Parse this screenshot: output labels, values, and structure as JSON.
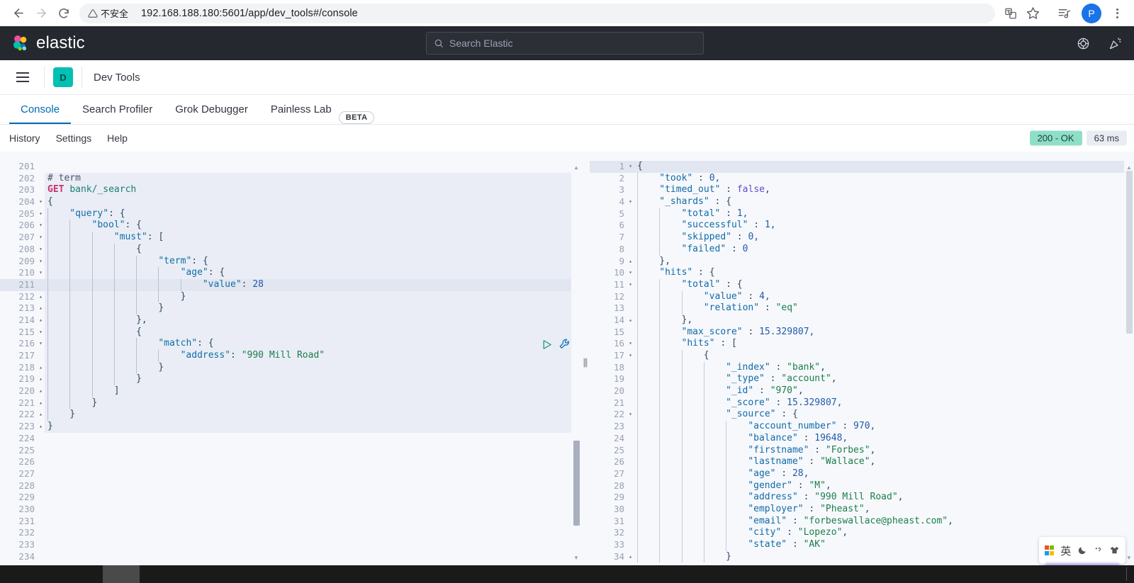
{
  "browser": {
    "back_icon": "back-arrow-icon",
    "forward_icon": "forward-arrow-icon",
    "reload_icon": "reload-icon",
    "security_label": "不安全",
    "url": "192.168.188.180:5601/app/dev_tools#/console",
    "translate_icon": "translate-icon",
    "bookmark_icon": "star-icon",
    "media_icon": "media-list-icon",
    "profile_initial": "P",
    "menu_icon": "kebab-menu-icon"
  },
  "elastic_header": {
    "brand": "elastic",
    "logo_icon": "elastic-logo-icon",
    "search_placeholder": "Search Elastic",
    "search_icon": "search-icon",
    "help_icon": "help-circle-icon",
    "news_icon": "announcement-icon"
  },
  "app_bar": {
    "menu_icon": "hamburger-menu-icon",
    "app_initial": "D",
    "title": "Dev Tools"
  },
  "tabs": [
    {
      "label": "Console",
      "active": true
    },
    {
      "label": "Search Profiler",
      "active": false
    },
    {
      "label": "Grok Debugger",
      "active": false
    },
    {
      "label": "Painless Lab",
      "active": false
    }
  ],
  "beta_badge": "BETA",
  "sub_toolbar": {
    "links": [
      "History",
      "Settings",
      "Help"
    ],
    "status_code": "200 - OK",
    "duration": "63 ms"
  },
  "editor": {
    "run_icon": "play-triangle-icon",
    "wrench_icon": "wrench-icon",
    "highlighted_line": 211,
    "lines": [
      {
        "n": 201,
        "fold": "",
        "indent": 0,
        "tokens": []
      },
      {
        "n": 202,
        "fold": "",
        "indent": 0,
        "tokens": [
          {
            "t": "comment",
            "v": "# term"
          }
        ]
      },
      {
        "n": 203,
        "fold": "",
        "indent": 0,
        "tokens": [
          {
            "t": "method",
            "v": "GET"
          },
          {
            "t": "plain",
            "v": " "
          },
          {
            "t": "url",
            "v": "bank/_search"
          }
        ]
      },
      {
        "n": 204,
        "fold": "down",
        "indent": 0,
        "tokens": [
          {
            "t": "brace",
            "v": "{"
          }
        ]
      },
      {
        "n": 205,
        "fold": "down",
        "indent": 1,
        "tokens": [
          {
            "t": "key",
            "v": "\"query\""
          },
          {
            "t": "punct",
            "v": ": {"
          }
        ]
      },
      {
        "n": 206,
        "fold": "down",
        "indent": 2,
        "tokens": [
          {
            "t": "key",
            "v": "\"bool\""
          },
          {
            "t": "punct",
            "v": ": {"
          }
        ]
      },
      {
        "n": 207,
        "fold": "down",
        "indent": 3,
        "tokens": [
          {
            "t": "key",
            "v": "\"must\""
          },
          {
            "t": "punct",
            "v": ": ["
          }
        ]
      },
      {
        "n": 208,
        "fold": "down",
        "indent": 4,
        "tokens": [
          {
            "t": "brace",
            "v": "{"
          }
        ]
      },
      {
        "n": 209,
        "fold": "down",
        "indent": 5,
        "tokens": [
          {
            "t": "key",
            "v": "\"term\""
          },
          {
            "t": "punct",
            "v": ": {"
          }
        ]
      },
      {
        "n": 210,
        "fold": "down",
        "indent": 6,
        "tokens": [
          {
            "t": "key",
            "v": "\"age\""
          },
          {
            "t": "punct",
            "v": ": {"
          }
        ]
      },
      {
        "n": 211,
        "fold": "",
        "indent": 7,
        "tokens": [
          {
            "t": "key",
            "v": "\"value\""
          },
          {
            "t": "punct",
            "v": ": "
          },
          {
            "t": "num",
            "v": "28"
          }
        ]
      },
      {
        "n": 212,
        "fold": "up",
        "indent": 6,
        "tokens": [
          {
            "t": "brace",
            "v": "}"
          }
        ]
      },
      {
        "n": 213,
        "fold": "up",
        "indent": 5,
        "tokens": [
          {
            "t": "brace",
            "v": "}"
          }
        ]
      },
      {
        "n": 214,
        "fold": "up",
        "indent": 4,
        "tokens": [
          {
            "t": "brace",
            "v": "},"
          }
        ]
      },
      {
        "n": 215,
        "fold": "down",
        "indent": 4,
        "tokens": [
          {
            "t": "brace",
            "v": "{"
          }
        ]
      },
      {
        "n": 216,
        "fold": "down",
        "indent": 5,
        "tokens": [
          {
            "t": "key",
            "v": "\"match\""
          },
          {
            "t": "punct",
            "v": ": {"
          }
        ]
      },
      {
        "n": 217,
        "fold": "",
        "indent": 6,
        "tokens": [
          {
            "t": "key",
            "v": "\"address\""
          },
          {
            "t": "punct",
            "v": ": "
          },
          {
            "t": "str",
            "v": "\"990 Mill Road\""
          }
        ]
      },
      {
        "n": 218,
        "fold": "up",
        "indent": 5,
        "tokens": [
          {
            "t": "brace",
            "v": "}"
          }
        ]
      },
      {
        "n": 219,
        "fold": "up",
        "indent": 4,
        "tokens": [
          {
            "t": "brace",
            "v": "}"
          }
        ]
      },
      {
        "n": 220,
        "fold": "up",
        "indent": 3,
        "tokens": [
          {
            "t": "brace",
            "v": "]"
          }
        ]
      },
      {
        "n": 221,
        "fold": "up",
        "indent": 2,
        "tokens": [
          {
            "t": "brace",
            "v": "}"
          }
        ]
      },
      {
        "n": 222,
        "fold": "up",
        "indent": 1,
        "tokens": [
          {
            "t": "brace",
            "v": "}"
          }
        ]
      },
      {
        "n": 223,
        "fold": "up",
        "indent": 0,
        "tokens": [
          {
            "t": "brace",
            "v": "}"
          }
        ]
      },
      {
        "n": 224,
        "fold": "",
        "indent": 0,
        "tokens": []
      },
      {
        "n": 225,
        "fold": "",
        "indent": 0,
        "tokens": []
      },
      {
        "n": 226,
        "fold": "",
        "indent": 0,
        "tokens": []
      },
      {
        "n": 227,
        "fold": "",
        "indent": 0,
        "tokens": []
      },
      {
        "n": 228,
        "fold": "",
        "indent": 0,
        "tokens": []
      },
      {
        "n": 229,
        "fold": "",
        "indent": 0,
        "tokens": []
      },
      {
        "n": 230,
        "fold": "",
        "indent": 0,
        "tokens": []
      },
      {
        "n": 231,
        "fold": "",
        "indent": 0,
        "tokens": []
      },
      {
        "n": 232,
        "fold": "",
        "indent": 0,
        "tokens": []
      },
      {
        "n": 233,
        "fold": "",
        "indent": 0,
        "tokens": []
      },
      {
        "n": 234,
        "fold": "",
        "indent": 0,
        "tokens": []
      }
    ]
  },
  "output": {
    "highlighted_line": 1,
    "lines": [
      {
        "n": 1,
        "fold": "down",
        "indent": 0,
        "tokens": [
          {
            "t": "brace",
            "v": "{"
          }
        ]
      },
      {
        "n": 2,
        "fold": "",
        "indent": 1,
        "tokens": [
          {
            "t": "okey",
            "v": "\"took\""
          },
          {
            "t": "punct",
            "v": " : "
          },
          {
            "t": "num",
            "v": "0,"
          }
        ]
      },
      {
        "n": 3,
        "fold": "",
        "indent": 1,
        "tokens": [
          {
            "t": "okey",
            "v": "\"timed_out\""
          },
          {
            "t": "punct",
            "v": " : "
          },
          {
            "t": "bool",
            "v": "false"
          },
          {
            "t": "punct",
            "v": ","
          }
        ]
      },
      {
        "n": 4,
        "fold": "down",
        "indent": 1,
        "tokens": [
          {
            "t": "okey",
            "v": "\"_shards\""
          },
          {
            "t": "punct",
            "v": " : {"
          }
        ]
      },
      {
        "n": 5,
        "fold": "",
        "indent": 2,
        "tokens": [
          {
            "t": "okey",
            "v": "\"total\""
          },
          {
            "t": "punct",
            "v": " : "
          },
          {
            "t": "num",
            "v": "1,"
          }
        ]
      },
      {
        "n": 6,
        "fold": "",
        "indent": 2,
        "tokens": [
          {
            "t": "okey",
            "v": "\"successful\""
          },
          {
            "t": "punct",
            "v": " : "
          },
          {
            "t": "num",
            "v": "1,"
          }
        ]
      },
      {
        "n": 7,
        "fold": "",
        "indent": 2,
        "tokens": [
          {
            "t": "okey",
            "v": "\"skipped\""
          },
          {
            "t": "punct",
            "v": " : "
          },
          {
            "t": "num",
            "v": "0,"
          }
        ]
      },
      {
        "n": 8,
        "fold": "",
        "indent": 2,
        "tokens": [
          {
            "t": "okey",
            "v": "\"failed\""
          },
          {
            "t": "punct",
            "v": " : "
          },
          {
            "t": "num",
            "v": "0"
          }
        ]
      },
      {
        "n": 9,
        "fold": "up",
        "indent": 1,
        "tokens": [
          {
            "t": "brace",
            "v": "},"
          }
        ]
      },
      {
        "n": 10,
        "fold": "down",
        "indent": 1,
        "tokens": [
          {
            "t": "okey",
            "v": "\"hits\""
          },
          {
            "t": "punct",
            "v": " : {"
          }
        ]
      },
      {
        "n": 11,
        "fold": "down",
        "indent": 2,
        "tokens": [
          {
            "t": "okey",
            "v": "\"total\""
          },
          {
            "t": "punct",
            "v": " : {"
          }
        ]
      },
      {
        "n": 12,
        "fold": "",
        "indent": 3,
        "tokens": [
          {
            "t": "okey",
            "v": "\"value\""
          },
          {
            "t": "punct",
            "v": " : "
          },
          {
            "t": "num",
            "v": "4,"
          }
        ]
      },
      {
        "n": 13,
        "fold": "",
        "indent": 3,
        "tokens": [
          {
            "t": "okey",
            "v": "\"relation\""
          },
          {
            "t": "punct",
            "v": " : "
          },
          {
            "t": "str",
            "v": "\"eq\""
          }
        ]
      },
      {
        "n": 14,
        "fold": "up",
        "indent": 2,
        "tokens": [
          {
            "t": "brace",
            "v": "},"
          }
        ]
      },
      {
        "n": 15,
        "fold": "",
        "indent": 2,
        "tokens": [
          {
            "t": "okey",
            "v": "\"max_score\""
          },
          {
            "t": "punct",
            "v": " : "
          },
          {
            "t": "num",
            "v": "15.329807,"
          }
        ]
      },
      {
        "n": 16,
        "fold": "down",
        "indent": 2,
        "tokens": [
          {
            "t": "okey",
            "v": "\"hits\""
          },
          {
            "t": "punct",
            "v": " : ["
          }
        ]
      },
      {
        "n": 17,
        "fold": "down",
        "indent": 3,
        "tokens": [
          {
            "t": "brace",
            "v": "{"
          }
        ]
      },
      {
        "n": 18,
        "fold": "",
        "indent": 4,
        "tokens": [
          {
            "t": "okey",
            "v": "\"_index\""
          },
          {
            "t": "punct",
            "v": " : "
          },
          {
            "t": "str",
            "v": "\"bank\""
          },
          {
            "t": "punct",
            "v": ","
          }
        ]
      },
      {
        "n": 19,
        "fold": "",
        "indent": 4,
        "tokens": [
          {
            "t": "okey",
            "v": "\"_type\""
          },
          {
            "t": "punct",
            "v": " : "
          },
          {
            "t": "str",
            "v": "\"account\""
          },
          {
            "t": "punct",
            "v": ","
          }
        ]
      },
      {
        "n": 20,
        "fold": "",
        "indent": 4,
        "tokens": [
          {
            "t": "okey",
            "v": "\"_id\""
          },
          {
            "t": "punct",
            "v": " : "
          },
          {
            "t": "str",
            "v": "\"970\""
          },
          {
            "t": "punct",
            "v": ","
          }
        ]
      },
      {
        "n": 21,
        "fold": "",
        "indent": 4,
        "tokens": [
          {
            "t": "okey",
            "v": "\"_score\""
          },
          {
            "t": "punct",
            "v": " : "
          },
          {
            "t": "num",
            "v": "15.329807,"
          }
        ]
      },
      {
        "n": 22,
        "fold": "down",
        "indent": 4,
        "tokens": [
          {
            "t": "okey",
            "v": "\"_source\""
          },
          {
            "t": "punct",
            "v": " : {"
          }
        ]
      },
      {
        "n": 23,
        "fold": "",
        "indent": 5,
        "tokens": [
          {
            "t": "okey",
            "v": "\"account_number\""
          },
          {
            "t": "punct",
            "v": " : "
          },
          {
            "t": "num",
            "v": "970,"
          }
        ]
      },
      {
        "n": 24,
        "fold": "",
        "indent": 5,
        "tokens": [
          {
            "t": "okey",
            "v": "\"balance\""
          },
          {
            "t": "punct",
            "v": " : "
          },
          {
            "t": "num",
            "v": "19648,"
          }
        ]
      },
      {
        "n": 25,
        "fold": "",
        "indent": 5,
        "tokens": [
          {
            "t": "okey",
            "v": "\"firstname\""
          },
          {
            "t": "punct",
            "v": " : "
          },
          {
            "t": "str",
            "v": "\"Forbes\""
          },
          {
            "t": "punct",
            "v": ","
          }
        ]
      },
      {
        "n": 26,
        "fold": "",
        "indent": 5,
        "tokens": [
          {
            "t": "okey",
            "v": "\"lastname\""
          },
          {
            "t": "punct",
            "v": " : "
          },
          {
            "t": "str",
            "v": "\"Wallace\""
          },
          {
            "t": "punct",
            "v": ","
          }
        ]
      },
      {
        "n": 27,
        "fold": "",
        "indent": 5,
        "tokens": [
          {
            "t": "okey",
            "v": "\"age\""
          },
          {
            "t": "punct",
            "v": " : "
          },
          {
            "t": "num",
            "v": "28,"
          }
        ]
      },
      {
        "n": 28,
        "fold": "",
        "indent": 5,
        "tokens": [
          {
            "t": "okey",
            "v": "\"gender\""
          },
          {
            "t": "punct",
            "v": " : "
          },
          {
            "t": "str",
            "v": "\"M\""
          },
          {
            "t": "punct",
            "v": ","
          }
        ]
      },
      {
        "n": 29,
        "fold": "",
        "indent": 5,
        "tokens": [
          {
            "t": "okey",
            "v": "\"address\""
          },
          {
            "t": "punct",
            "v": " : "
          },
          {
            "t": "str",
            "v": "\"990 Mill Road\""
          },
          {
            "t": "punct",
            "v": ","
          }
        ]
      },
      {
        "n": 30,
        "fold": "",
        "indent": 5,
        "tokens": [
          {
            "t": "okey",
            "v": "\"employer\""
          },
          {
            "t": "punct",
            "v": " : "
          },
          {
            "t": "str",
            "v": "\"Pheast\""
          },
          {
            "t": "punct",
            "v": ","
          }
        ]
      },
      {
        "n": 31,
        "fold": "",
        "indent": 5,
        "tokens": [
          {
            "t": "okey",
            "v": "\"email\""
          },
          {
            "t": "punct",
            "v": " : "
          },
          {
            "t": "str",
            "v": "\"forbeswallace@pheast.com\""
          },
          {
            "t": "punct",
            "v": ","
          }
        ]
      },
      {
        "n": 32,
        "fold": "",
        "indent": 5,
        "tokens": [
          {
            "t": "okey",
            "v": "\"city\""
          },
          {
            "t": "punct",
            "v": " : "
          },
          {
            "t": "str",
            "v": "\"Lopezo\""
          },
          {
            "t": "punct",
            "v": ","
          }
        ]
      },
      {
        "n": 33,
        "fold": "",
        "indent": 5,
        "tokens": [
          {
            "t": "okey",
            "v": "\"state\""
          },
          {
            "t": "punct",
            "v": " : "
          },
          {
            "t": "str",
            "v": "\"AK\""
          }
        ]
      },
      {
        "n": 34,
        "fold": "up",
        "indent": 4,
        "tokens": [
          {
            "t": "brace",
            "v": "}"
          }
        ]
      }
    ]
  },
  "splitter": {
    "handle": "⫼"
  },
  "ime": {
    "logo_icon": "windows-logo-icon",
    "mode": "英",
    "moon_icon": "moon-icon",
    "punct_icon": "punctuation-icon",
    "skin_icon": "tshirt-icon"
  },
  "taskbar": {
    "clock": ""
  },
  "colors": {
    "elastic_dark": "#25282f",
    "accent_blue": "#006bb4",
    "teal": "#00bfb3",
    "success_green": "#8fdfc8",
    "string_green": "#1a7f4b",
    "key_blue": "#0f6ea8",
    "method_pink": "#c4326d"
  }
}
